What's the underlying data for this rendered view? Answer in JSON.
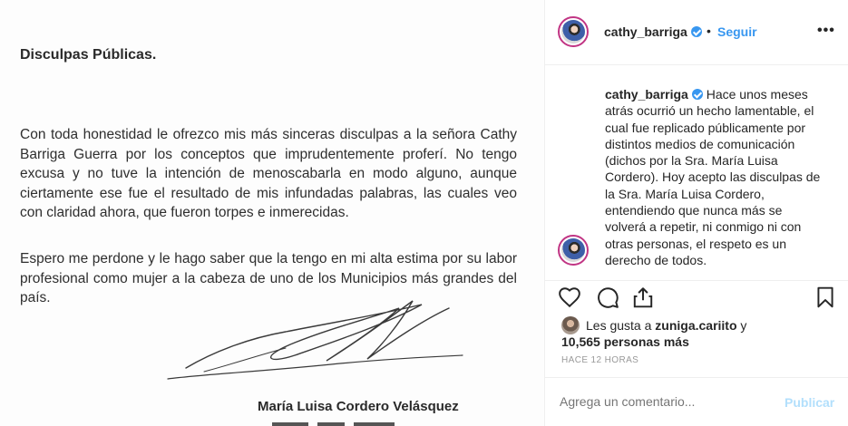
{
  "letter": {
    "heading": "Disculpas Públicas.",
    "paragraph1": "Con toda honestidad le ofrezco mis más sinceras disculpas a la señora Cathy Barriga Guerra por los conceptos que imprudentemente proferí. No tengo excusa y no tuve la intención de menoscabarla en modo alguno, aunque ciertamente ese fue el resultado de mis infundadas palabras, las cuales veo con claridad ahora, que fueron torpes e inmerecidas.",
    "paragraph2": "Espero me perdone y le hago saber que la tengo en mi alta estima por su labor profesional como mujer a la cabeza de uno de los Municipios más grandes del país.",
    "signer": "María Luisa Cordero Velásquez"
  },
  "post": {
    "username": "cathy_barriga",
    "dot": "•",
    "follow_label": "Seguir",
    "more": "•••",
    "caption_username": "cathy_barriga",
    "caption_text": "Hace unos meses atrás ocurrió un hecho lamentable, el cual fue replicado públicamente por distintos medios de comunicación (dichos por la Sra. María Luisa Cordero). Hoy acepto las disculpas de la Sra. María Luisa Cordero, entendiendo que nunca más se volverá a repetir, ni conmigo ni con otras personas, el respeto es un derecho de todos.",
    "likes_prefix": "Les gusta a",
    "likes_user": "zuniga.cariito",
    "likes_and": "y",
    "likes_count": "10,565 personas más",
    "timestamp": "HACE 12 HORAS",
    "comment_placeholder": "Agrega un comentario...",
    "publish_label": "Publicar"
  },
  "colors": {
    "accent": "#3897f0",
    "publish_disabled": "#b2dffc",
    "muted": "#999999",
    "border": "#efefef"
  },
  "icons": [
    "verified-badge-icon",
    "heart-icon",
    "comment-icon",
    "share-icon",
    "bookmark-icon",
    "more-options-icon"
  ]
}
